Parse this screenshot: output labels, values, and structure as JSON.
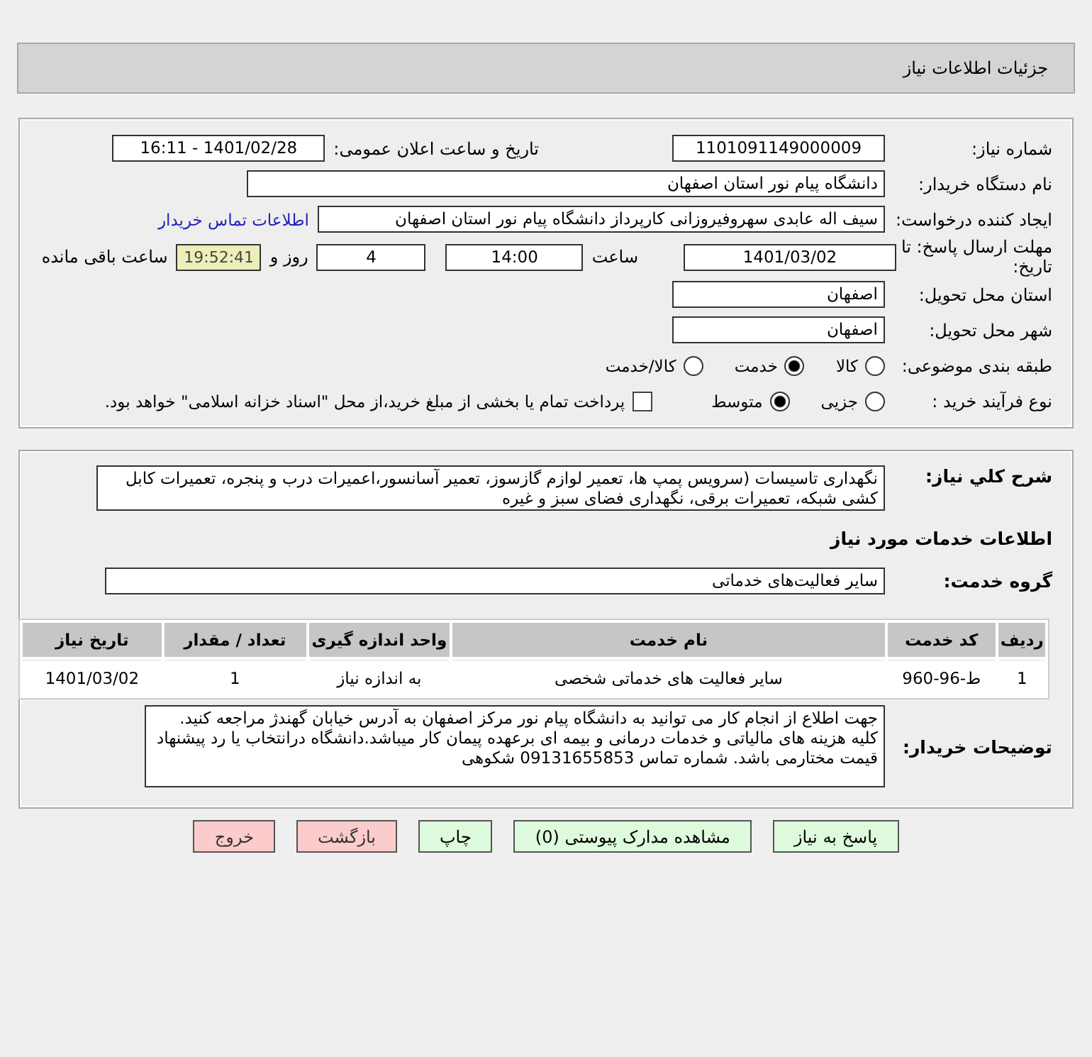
{
  "header": {
    "title": "جزئیات اطلاعات نیاز"
  },
  "need_number": {
    "label": "شماره نیاز:",
    "value": "1101091149000009"
  },
  "announce": {
    "label": "تاریخ و ساعت اعلان عمومی:",
    "value": "1401/02/28 - 16:11"
  },
  "buyer": {
    "label": "نام دستگاه خریدار:",
    "value": "دانشگاه پیام نور استان اصفهان"
  },
  "creator": {
    "label": "ایجاد کننده درخواست:",
    "value": "سیف اله عابدی سهروفیروزانی کارپرداز دانشگاه پیام نور استان اصفهان",
    "link": "اطلاعات تماس خریدار"
  },
  "deadline": {
    "label": "مهلت ارسال پاسخ: تا تاریخ:",
    "date": "1401/03/02",
    "time_label": "ساعت",
    "time": "14:00",
    "days": "4",
    "days_label": "روز و",
    "remaining": "19:52:41",
    "remaining_label": "ساعت باقی مانده"
  },
  "province": {
    "label": "استان محل تحویل:",
    "value": "اصفهان"
  },
  "city": {
    "label": "شهر محل تحویل:",
    "value": "اصفهان"
  },
  "category": {
    "label": "طبقه بندی موضوعی:",
    "options": [
      {
        "label": "کالا",
        "selected": false
      },
      {
        "label": "خدمت",
        "selected": true
      },
      {
        "label": "کالا/خدمت",
        "selected": false
      }
    ]
  },
  "purchase_type": {
    "label": "نوع فرآیند خرید :",
    "options": [
      {
        "label": "جزیی",
        "selected": false
      },
      {
        "label": "متوسط",
        "selected": true
      }
    ],
    "treasury": {
      "checked": false,
      "text": "پرداخت تمام یا بخشی از مبلغ خرید،از محل \"اسناد خزانه اسلامی\" خواهد بود."
    }
  },
  "description": {
    "label": "شرح کلي نیاز:",
    "value": "نگهداری تاسیسات (سرویس پمپ ها، تعمیر لوازم گازسوز، تعمیر آسانسور،اعمیرات درب و پنجره، تعمیرات کابل کشی شبکه، تعمیرات برقی، نگهداری فضای سبز و غیره"
  },
  "services_heading": "اطلاعات خدمات مورد نیاز",
  "service_group": {
    "label": "گروه خدمت:",
    "value": "سایر فعالیت‌های خدماتی"
  },
  "table": {
    "columns": [
      "ردیف",
      "کد خدمت",
      "نام خدمت",
      "واحد اندازه گیری",
      "تعداد / مقدار",
      "تاریخ نیاز"
    ],
    "rows": [
      [
        "1",
        "ط-96-960",
        "سایر فعالیت های خدماتی شخصی",
        "به اندازه نیاز",
        "1",
        "1401/03/02"
      ]
    ]
  },
  "buyer_notes": {
    "label": "توضیحات خریدار:",
    "value": "جهت اطلاع از انجام کار می توانید به دانشگاه پیام نور مرکز اصفهان به آدرس خیابان گهندژ مراجعه کنید. کلیه هزینه های مالیاتی و خدمات درمانی و بیمه ای برعهده پیمان کار میباشد.دانشگاه درانتخاب یا رد پیشنهاد قیمت مختارمی باشد. شمارە تماس 09131655853 شکوهی"
  },
  "buttons": [
    {
      "label": "پاسخ به نیاز",
      "kind": "normal"
    },
    {
      "label": "مشاهده مدارک پیوستی (0)",
      "kind": "normal"
    },
    {
      "label": "چاپ",
      "kind": "normal"
    },
    {
      "label": "بازگشت",
      "kind": "danger"
    },
    {
      "label": "خروج",
      "kind": "danger"
    }
  ]
}
